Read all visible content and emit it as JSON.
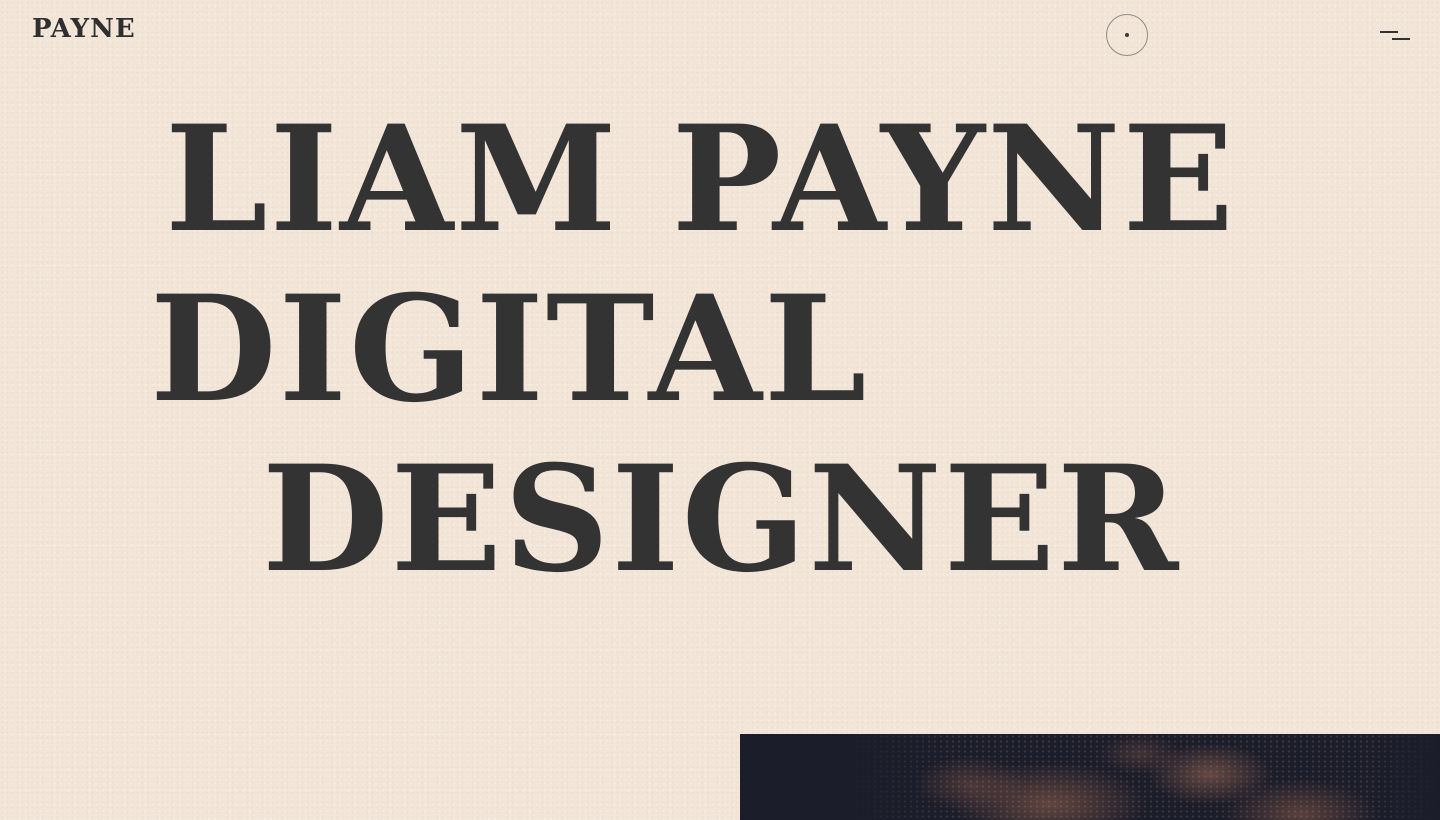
{
  "header": {
    "logo": "PAYNE",
    "menu_icon": "menu-icon",
    "cursor_icon": "cursor-circle-icon"
  },
  "hero": {
    "lines": [
      "LIAM PAYNE",
      "DIGITAL",
      "DESIGNER"
    ]
  },
  "media": {
    "image_desc_icon": "hero-photo"
  },
  "colors": {
    "background": "#f3e6d9",
    "text": "#333333",
    "image_dark": "#1b1d2a"
  }
}
